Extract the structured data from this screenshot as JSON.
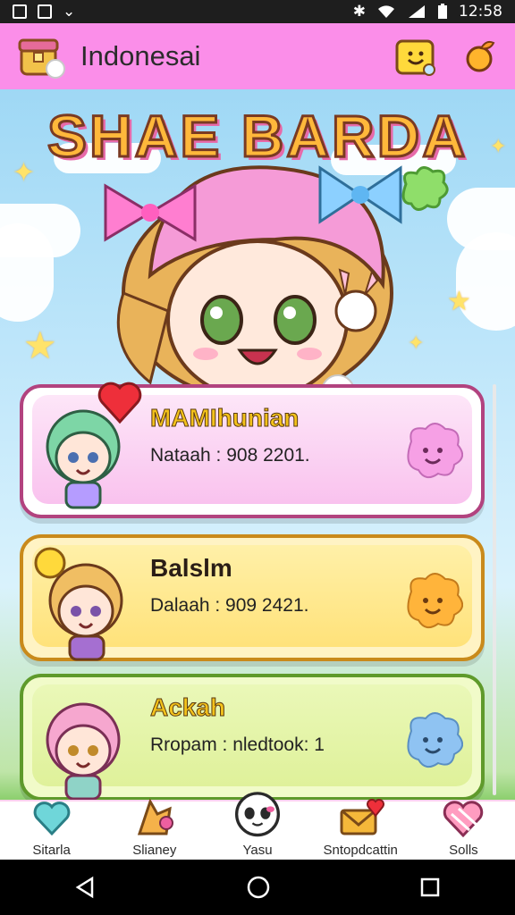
{
  "status_bar": {
    "time": "12:58"
  },
  "app_bar": {
    "title": "Indonesai",
    "logo_icon": "treasure-bag-icon",
    "action_icons": [
      "smile-badge-icon",
      "fruit-icon"
    ]
  },
  "banner": {
    "text": "SHAE BARDA"
  },
  "cards": [
    {
      "name": "MAMIhunian",
      "detail": "Nataah : 908  2201.",
      "color": "#f9c2ee",
      "border": "#b2437f",
      "blob_color": "#f6a0e5"
    },
    {
      "name": "Balslm",
      "detail": "Dalaah : 909  2421.",
      "color": "#ffe27a",
      "border": "#c98a1b",
      "blob_color": "#ffb43b"
    },
    {
      "name": "Ackah",
      "detail": "Rropam : nledtook:   1",
      "color": "#dff19a",
      "border": "#5f9a2b",
      "blob_color": "#8fc3f2"
    }
  ],
  "bottom_nav": [
    {
      "label": "Sitarla",
      "icon": "heart-balloon-icon"
    },
    {
      "label": "Slianey",
      "icon": "fox-icon"
    },
    {
      "label": "Yasu",
      "icon": "panda-face-icon"
    },
    {
      "label": "Sntopdcattin",
      "icon": "envelope-heart-icon"
    },
    {
      "label": "Solls",
      "icon": "striped-heart-icon"
    }
  ],
  "colors": {
    "accent": "#fb8ee9",
    "nav_bg": "#ffffff",
    "status_bg": "#1e1e1e"
  }
}
